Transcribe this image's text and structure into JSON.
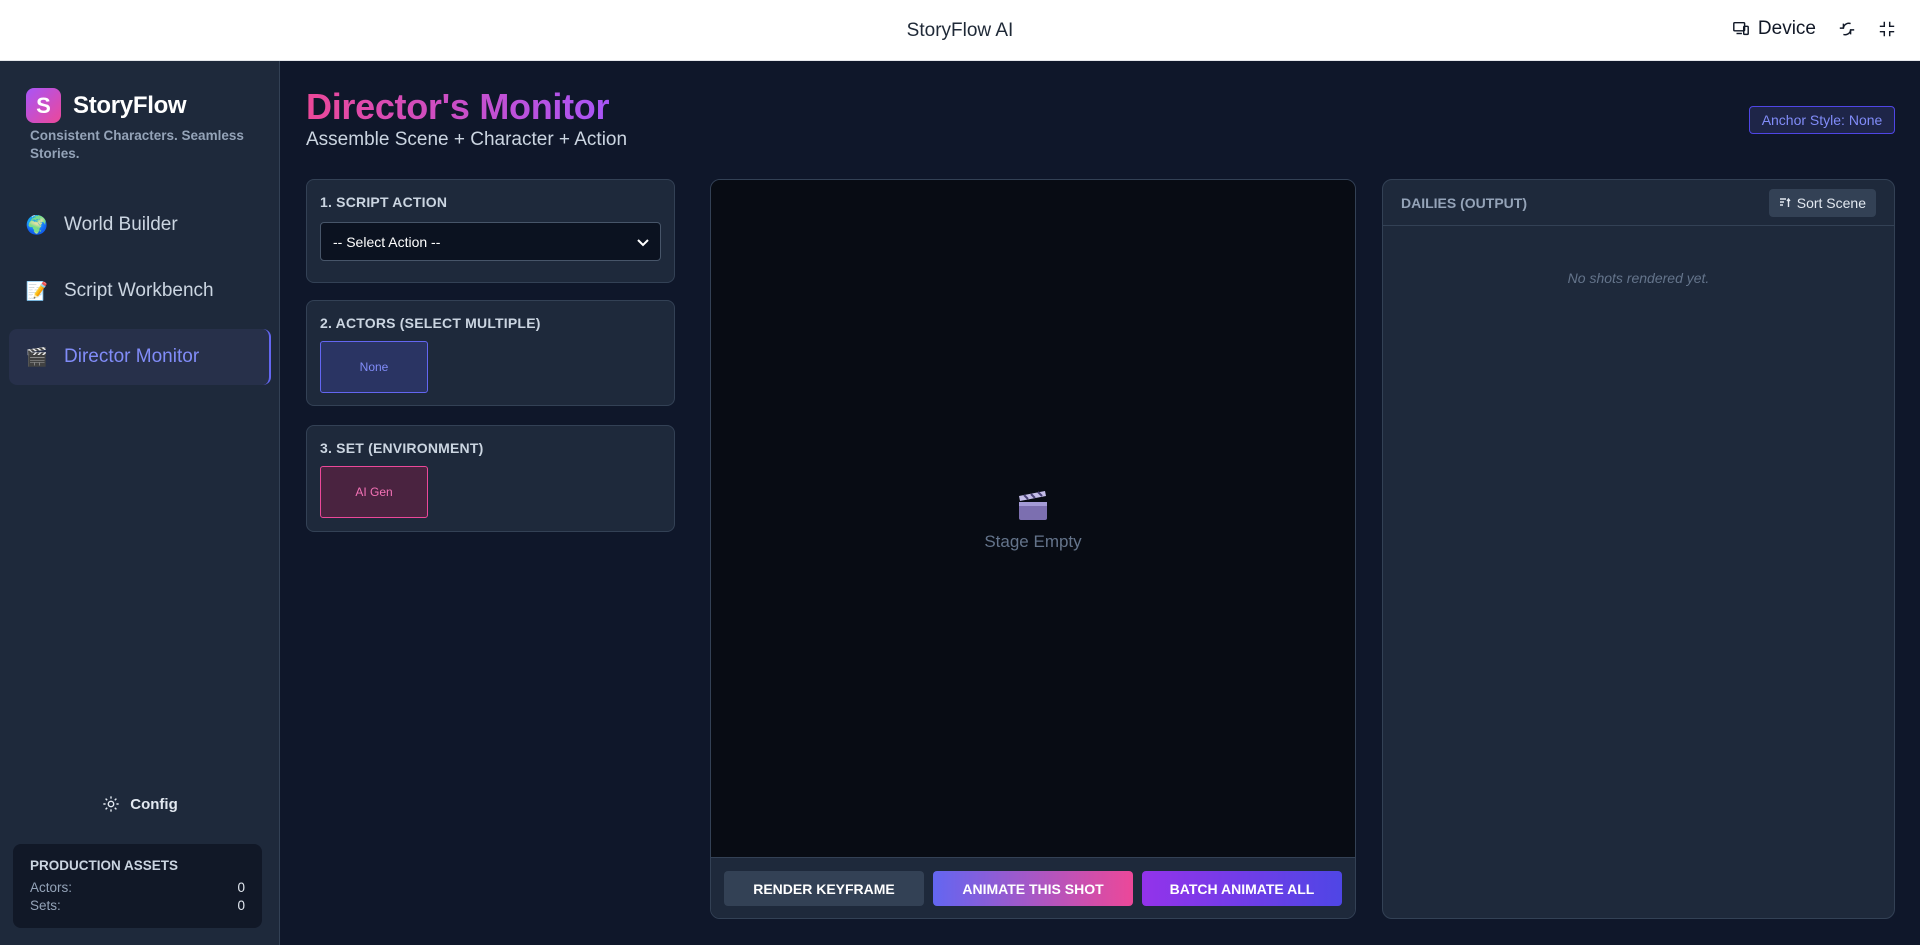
{
  "topbar": {
    "title": "StoryFlow AI",
    "device_label": "Device"
  },
  "sidebar": {
    "brand_letter": "S",
    "brand_name": "StoryFlow",
    "tagline": "Consistent Characters. Seamless Stories.",
    "items": [
      {
        "label": "World Builder",
        "icon": "globe-icon"
      },
      {
        "label": "Script Workbench",
        "icon": "memo-icon"
      },
      {
        "label": "Director Monitor",
        "icon": "clapper-icon",
        "active": true
      }
    ],
    "config_label": "Config",
    "assets": {
      "heading": "PRODUCTION ASSETS",
      "actors_label": "Actors:",
      "actors_value": "0",
      "sets_label": "Sets:",
      "sets_value": "0"
    }
  },
  "main": {
    "title": "Director's Monitor",
    "subtitle": "Assemble Scene + Character + Action",
    "anchor_style": "Anchor Style: None",
    "script_action": {
      "label": "1. SCRIPT ACTION",
      "selected": "-- Select Action --"
    },
    "actors": {
      "label": "2. ACTORS (SELECT MULTIPLE)",
      "chip": "None"
    },
    "set": {
      "label": "3. SET (ENVIRONMENT)",
      "chip": "AI Gen"
    },
    "stage": {
      "empty_text": "Stage Empty",
      "render_label": "RENDER KEYFRAME",
      "animate_label": "ANIMATE THIS SHOT",
      "batch_label": "BATCH ANIMATE ALL"
    },
    "dailies": {
      "title": "DAILIES (OUTPUT)",
      "sort_label": "Sort Scene",
      "empty_text": "No shots rendered yet."
    }
  },
  "colors": {
    "accent_indigo": "#6366f1",
    "accent_pink": "#ec4899",
    "accent_purple": "#a855f7",
    "background": "#0f172a"
  }
}
